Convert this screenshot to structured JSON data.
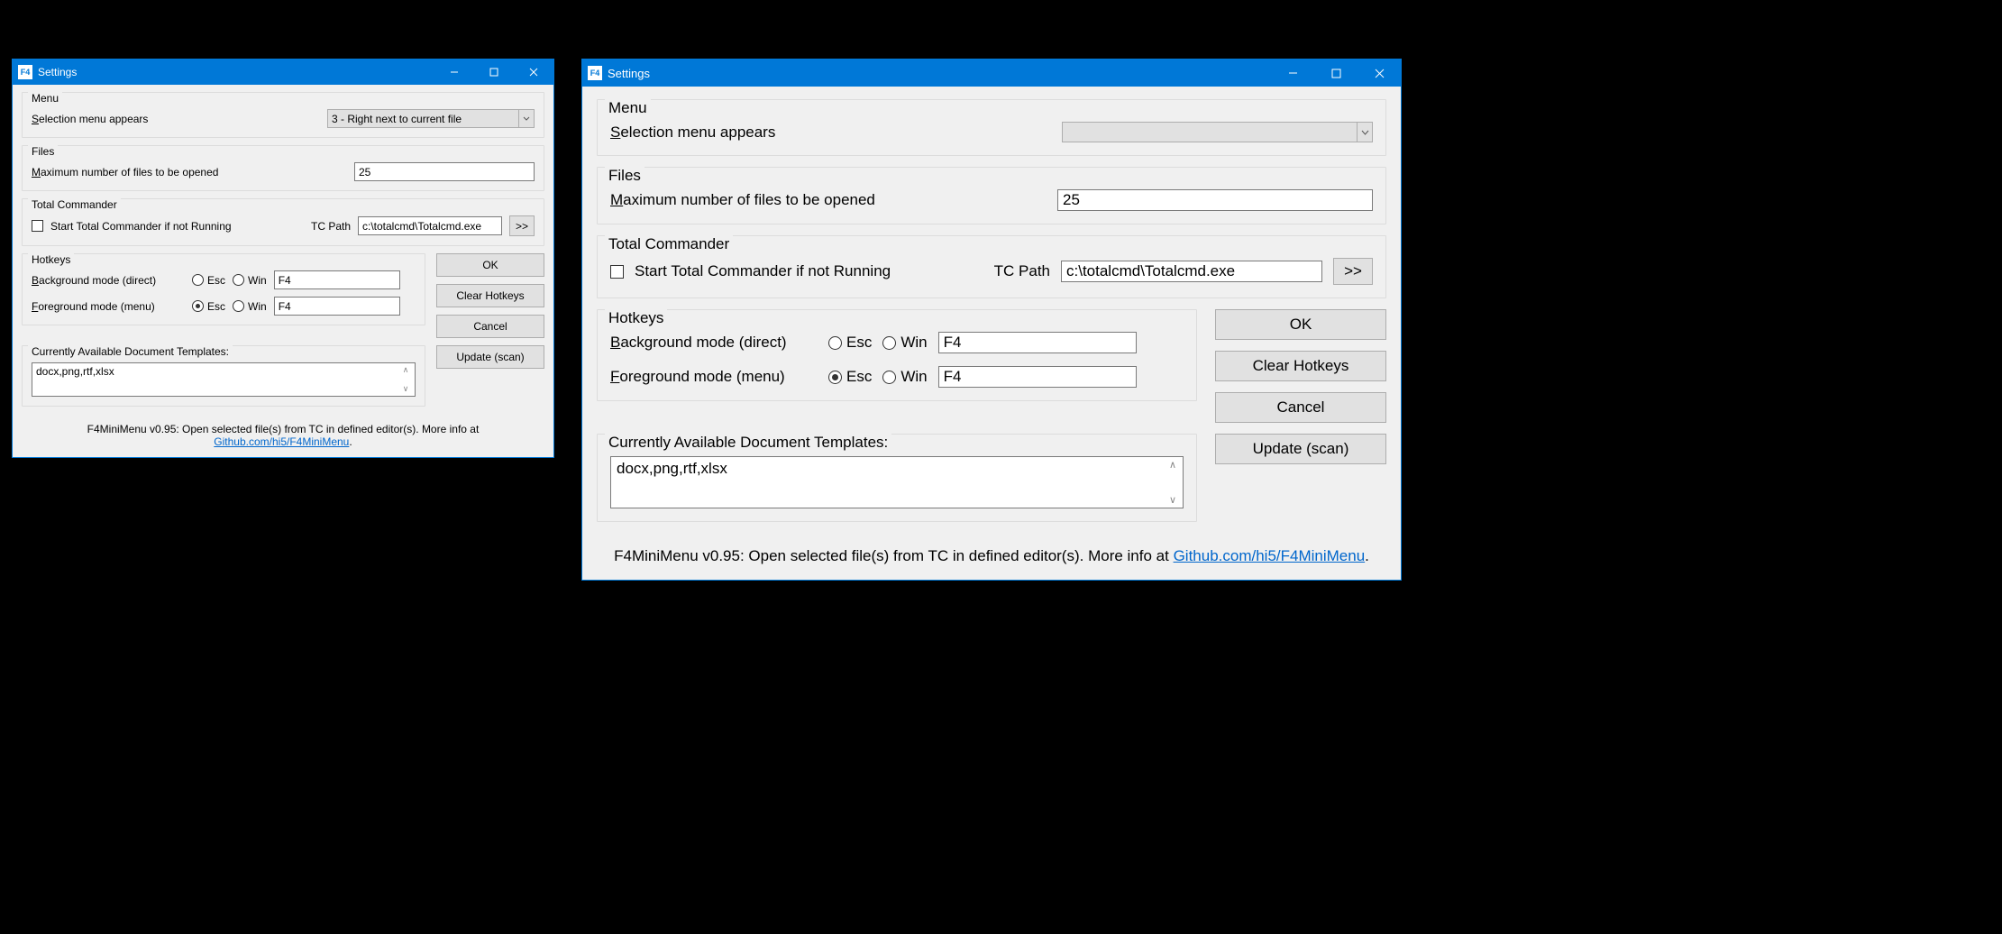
{
  "window_title": "Settings",
  "menu": {
    "legend": "Menu",
    "selection_label_pre": "S",
    "selection_label_rest": "election menu appears",
    "selection_value": "3 - Right next to current file"
  },
  "files": {
    "legend": "Files",
    "max_label_pre": "M",
    "max_label_rest": "aximum number of files to be opened",
    "max_value": "25"
  },
  "tc": {
    "legend": "Total Commander",
    "start_label": "Start Total Commander if not Running",
    "path_label": "TC Path",
    "path_value": "c:\\totalcmd\\Totalcmd.exe",
    "browse_label": ">>"
  },
  "hotkeys": {
    "legend": "Hotkeys",
    "bg_label_pre": "B",
    "bg_label_rest": "ackground mode (direct)",
    "fg_label_pre": "F",
    "fg_label_rest": "oreground mode (menu)",
    "esc_label": "Esc",
    "win_label": "Win",
    "bg_value": "F4",
    "fg_value": "F4"
  },
  "buttons": {
    "ok": "OK",
    "clear": "Clear Hotkeys",
    "cancel": "Cancel",
    "update": "Update (scan)"
  },
  "templates": {
    "legend": "Currently Available Document Templates:",
    "value": "docx,png,rtf,xlsx"
  },
  "footer": {
    "text": "F4MiniMenu v0.95: Open selected file(s) from TC in defined editor(s). More info at ",
    "link": "Github.com/hi5/F4MiniMenu",
    "period": "."
  }
}
